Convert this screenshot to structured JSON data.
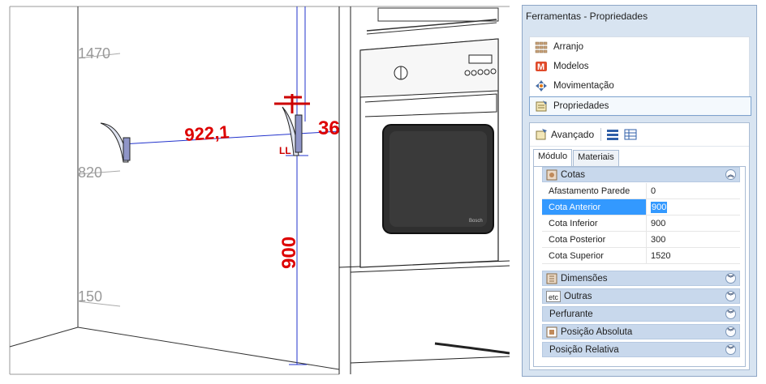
{
  "viewport": {
    "wall_labels": [
      "1470",
      "820",
      "150"
    ],
    "dim_horizontal": "922,1",
    "dim_vertical": "900",
    "dim_partial": "36",
    "oven_brand": "Bosch"
  },
  "panel": {
    "title": "Ferramentas - Propriedades",
    "nav": [
      {
        "label": "Arranjo",
        "icon": "grid-arrangement-icon"
      },
      {
        "label": "Modelos",
        "icon": "models-m-icon"
      },
      {
        "label": "Movimentação",
        "icon": "move-arrows-icon"
      },
      {
        "label": "Propriedades",
        "icon": "properties-icon"
      }
    ],
    "toolbar_label": "Avançado",
    "tabs": [
      "Módulo",
      "Materiais"
    ],
    "sections": {
      "cotas": "Cotas",
      "dimensoes": "Dimensões",
      "outras": "Outras",
      "perfurante": "Perfurante",
      "posicao_absoluta": "Posição Absoluta",
      "posicao_relativa": "Posição Relativa"
    },
    "cotas_rows": [
      {
        "name": "Afastamento Parede",
        "value": "0"
      },
      {
        "name": "Cota Anterior",
        "value": "900"
      },
      {
        "name": "Cota Inferior",
        "value": "900"
      },
      {
        "name": "Cota Posterior",
        "value": "300"
      },
      {
        "name": "Cota Superior",
        "value": "1520"
      }
    ],
    "outras_icon_text": "etc",
    "accent_color": "#3399ff"
  }
}
